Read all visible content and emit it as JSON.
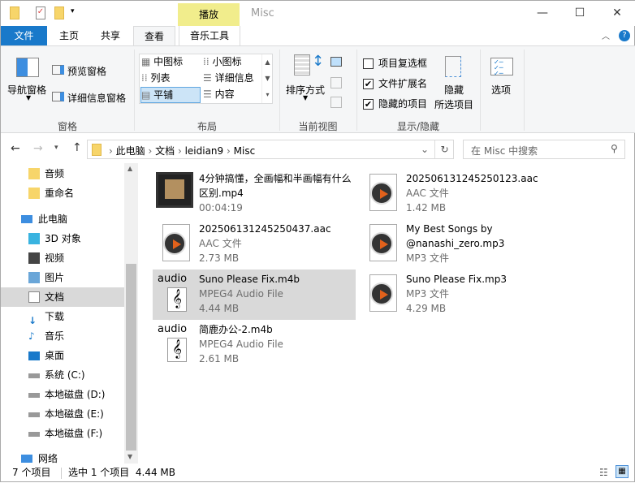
{
  "window": {
    "title": "Misc",
    "context_tab": "播放",
    "minimize": "—",
    "maximize": "☐",
    "close": "✕"
  },
  "tabs": [
    "文件",
    "主页",
    "共享",
    "查看",
    "音乐工具"
  ],
  "ribbon": {
    "panes": {
      "nav": "导航窗格",
      "preview": "预览窗格",
      "details": "详细信息窗格",
      "label": "窗格"
    },
    "layout": {
      "items": [
        "中图标",
        "小图标",
        "列表",
        "详细信息",
        "平铺",
        "内容"
      ],
      "label": "布局"
    },
    "view": {
      "sort": "排序方式",
      "label": "当前视图"
    },
    "showhide": {
      "checkbox": "项目复选框",
      "ext": "文件扩展名",
      "hidden": "隐藏的项目",
      "hide_sel_1": "隐藏",
      "hide_sel_2": "所选项目",
      "label": "显示/隐藏"
    },
    "options": "选项"
  },
  "address": {
    "path": [
      "此电脑",
      "文档",
      "leidian9",
      "Misc"
    ],
    "search_placeholder": "在 Misc 中搜索"
  },
  "nav": [
    "音频",
    "重命名",
    "此电脑",
    "3D 对象",
    "视频",
    "图片",
    "文档",
    "下载",
    "音乐",
    "桌面",
    "系统 (C:)",
    "本地磁盘 (D:)",
    "本地磁盘 (E:)",
    "本地磁盘 (F:)",
    "网络"
  ],
  "files": [
    {
      "name": "4分钟搞懂，全画幅和半画幅有什么区别.mp4",
      "type": "",
      "size": "00:04:19"
    },
    {
      "name": "202506131245250123.aac",
      "type": "AAC 文件",
      "size": "1.42 MB"
    },
    {
      "name": "202506131245250437.aac",
      "type": "AAC 文件",
      "size": "2.73 MB"
    },
    {
      "name": "My Best Songs by @nanashi_zero.mp3",
      "type": "MP3 文件",
      "size": ""
    },
    {
      "name": "Suno Please Fix.m4b",
      "type": "MPEG4 Audio File",
      "size": "4.44 MB"
    },
    {
      "name": "Suno Please Fix.mp3",
      "type": "MP3 文件",
      "size": "4.29 MB"
    },
    {
      "name": "简鹿办公-2.m4b",
      "type": "MPEG4 Audio File",
      "size": "2.61 MB"
    }
  ],
  "thumb_label": "audio",
  "status": {
    "count": "7 个项目",
    "selected": "选中 1 个项目  4.44 MB"
  },
  "colors": {
    "accent": "#1979ca",
    "selection": "#d9d9d9",
    "context": "#f1ed8c"
  }
}
